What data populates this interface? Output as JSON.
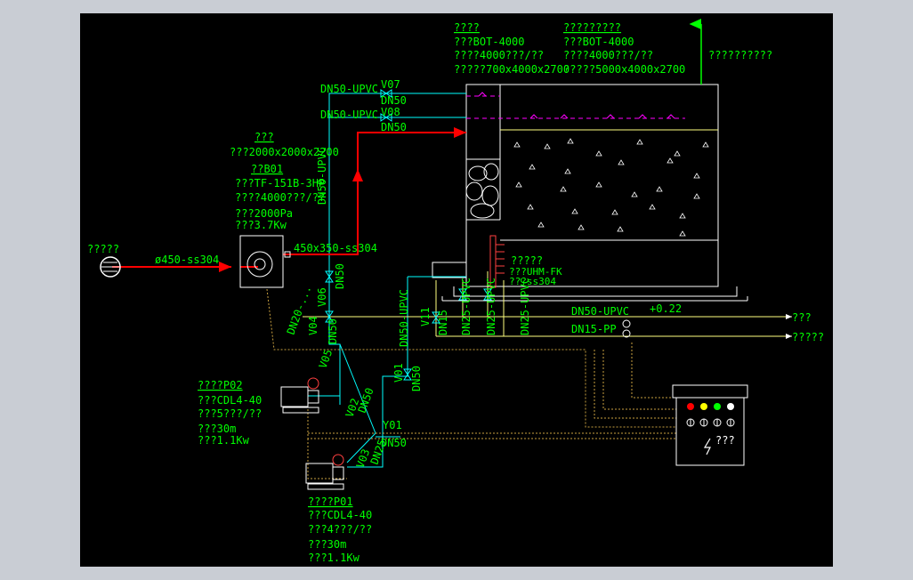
{
  "colors": {
    "background": "#000000",
    "frame": "#c9cdd4",
    "label": "#00ff00",
    "pipe_water": "#ffff80",
    "pipe_air": "#ff0000",
    "pipe_cyan": "#00ffff",
    "magenta": "#ff00ff",
    "white": "#ffffff",
    "cable": "#c8a040"
  },
  "labels": {
    "tank_a_title": "????",
    "tank_a_model": "???BOT-4000",
    "tank_a_capacity": "????4000???/??",
    "tank_a_size": "?????700x4000x2700",
    "tank_b_title": "?????????",
    "tank_b_model": "???BOT-4000",
    "tank_b_capacity": "????4000???/??",
    "tank_b_size": "?????5000x4000x2700",
    "vent_note": "??????????",
    "muffler_title": "???",
    "muffler_size": "???2000x2000x2200",
    "blower_id": "??B01",
    "blower_model": "???TF-151B-3HP",
    "blower_flow": "????4000???/??",
    "blower_pressure": "???2000Pa",
    "blower_power": "???3.7Kw",
    "air_inlet": "?????",
    "air_duct": "ø450-ss304",
    "duct_reducer": "450x350-ss304",
    "pipe_v07": "DN50-UPVC",
    "pipe_v07_tag": "V07",
    "pipe_v07_dn": "DN50",
    "pipe_v08": "DN50-UPVC",
    "pipe_v08_tag": "V08",
    "pipe_v08_dn": "DN50",
    "vert_upvc": "DN50-UPVC",
    "dn50_a": "DN50",
    "dn50_b": "DN50",
    "dn50_upvc_c": "DN50-UPVC",
    "v06": "V06",
    "v04": "V04",
    "v05": "V05",
    "dn20": "DN20-...",
    "v01": "V01",
    "dn50_v01": "DN50",
    "y01": "Y01",
    "dn50_y01": "DN50",
    "v02": "V02",
    "v03": "V03",
    "dn50_v02": "DN50",
    "dn25_v03": "DN25",
    "v11": "V11",
    "dn15_v11": "DN15",
    "dn25_v10": "DN25-UPVC",
    "dn25_v09": "DN25-UPVC",
    "dn25_v12": "DN25-UPVC",
    "level_gauge": "?????",
    "level_model": "???UHM-FK",
    "level_material": "???ss304",
    "outlet_pipe": "DN50-UPVC",
    "outlet_level": "+0.22",
    "outlet_dest": "???",
    "drain_pipe": "DN15-PP",
    "drain_dest": "?????",
    "pump2_id": "????P02",
    "pump2_model": "???CDL4-40",
    "pump2_flow": "???5???/??",
    "pump2_head": "???30m",
    "pump2_power": "???1.1Kw",
    "pump1_id": "????P01",
    "pump1_model": "???CDL4-40",
    "pump1_flow": "???4???/??",
    "pump1_head": "???30m",
    "pump1_power": "???1.1Kw",
    "control_panel": "???"
  },
  "control_panel": {
    "lamps": [
      "#ff0000",
      "#ffff00",
      "#00ff00",
      "#ffffff"
    ]
  }
}
